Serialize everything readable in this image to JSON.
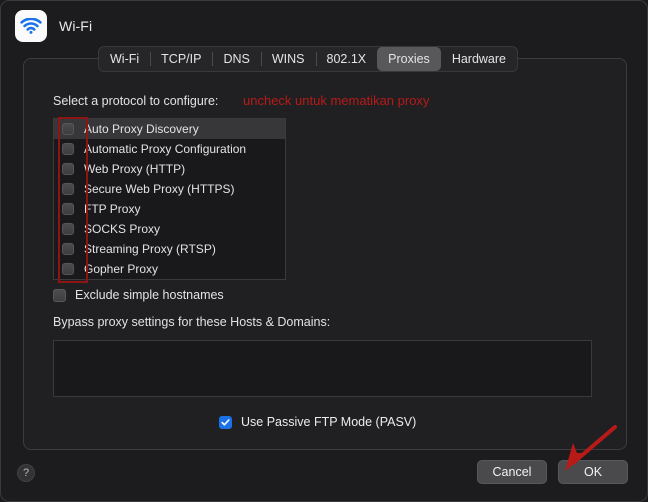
{
  "window": {
    "title": "Wi-Fi",
    "icon": "wifi-icon"
  },
  "tabs": [
    {
      "label": "Wi-Fi",
      "selected": false
    },
    {
      "label": "TCP/IP",
      "selected": false
    },
    {
      "label": "DNS",
      "selected": false
    },
    {
      "label": "WINS",
      "selected": false
    },
    {
      "label": "802.1X",
      "selected": false
    },
    {
      "label": "Proxies",
      "selected": true
    },
    {
      "label": "Hardware",
      "selected": false
    }
  ],
  "main": {
    "protocol_label": "Select a protocol to configure:",
    "protocols": [
      {
        "label": "Auto Proxy Discovery",
        "checked": false,
        "selected": true
      },
      {
        "label": "Automatic Proxy Configuration",
        "checked": false,
        "selected": false
      },
      {
        "label": "Web Proxy (HTTP)",
        "checked": false,
        "selected": false
      },
      {
        "label": "Secure Web Proxy (HTTPS)",
        "checked": false,
        "selected": false
      },
      {
        "label": "FTP Proxy",
        "checked": false,
        "selected": false
      },
      {
        "label": "SOCKS Proxy",
        "checked": false,
        "selected": false
      },
      {
        "label": "Streaming Proxy (RTSP)",
        "checked": false,
        "selected": false
      },
      {
        "label": "Gopher Proxy",
        "checked": false,
        "selected": false
      }
    ],
    "exclude_simple_hostnames": {
      "label": "Exclude simple hostnames",
      "checked": false
    },
    "bypass_label": "Bypass proxy settings for these Hosts & Domains:",
    "bypass_value": "",
    "bypass_placeholder": "",
    "passive_ftp": {
      "label": "Use Passive FTP Mode (PASV)",
      "checked": true
    }
  },
  "footer": {
    "help_label": "?",
    "cancel_label": "Cancel",
    "ok_label": "OK"
  },
  "annotations": {
    "note_text": "uncheck untuk mematikan proxy",
    "note_color": "#b81a18",
    "box_color": "#8d1513",
    "arrow_color": "#b81a18",
    "arrow_target": "OK"
  },
  "colors": {
    "window_bg": "#1c1c1e",
    "panel_bg": "#202022",
    "list_bg": "#19191b",
    "accent_blue": "#1b72e8",
    "selected_row": "#37373a",
    "button_bg": "#4a4a4d"
  }
}
